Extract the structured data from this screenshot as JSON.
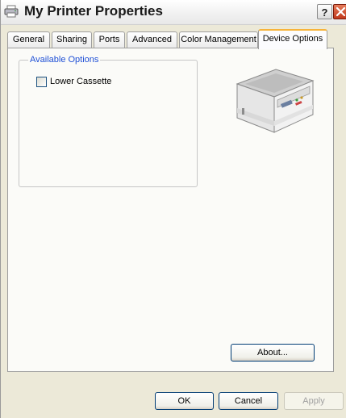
{
  "window": {
    "title": "My Printer Properties"
  },
  "titlebar": {
    "help_label": "?"
  },
  "tabs": [
    {
      "label": "General"
    },
    {
      "label": "Sharing"
    },
    {
      "label": "Ports"
    },
    {
      "label": "Advanced"
    },
    {
      "label": "Color Management"
    },
    {
      "label": "Device Options"
    }
  ],
  "active_tab": "Device Options",
  "options": {
    "group_label": "Available Options",
    "items": [
      {
        "label": "Lower Cassette",
        "checked": false
      }
    ]
  },
  "buttons": {
    "about": "About...",
    "ok": "OK",
    "cancel": "Cancel",
    "apply": "Apply"
  },
  "colors": {
    "group_label": "#1e4fd6",
    "active_tab_accent": "#f7b33a",
    "close_button": "#c0391c"
  },
  "icons": [
    "printer-icon",
    "help-icon",
    "close-icon",
    "printer-image"
  ]
}
